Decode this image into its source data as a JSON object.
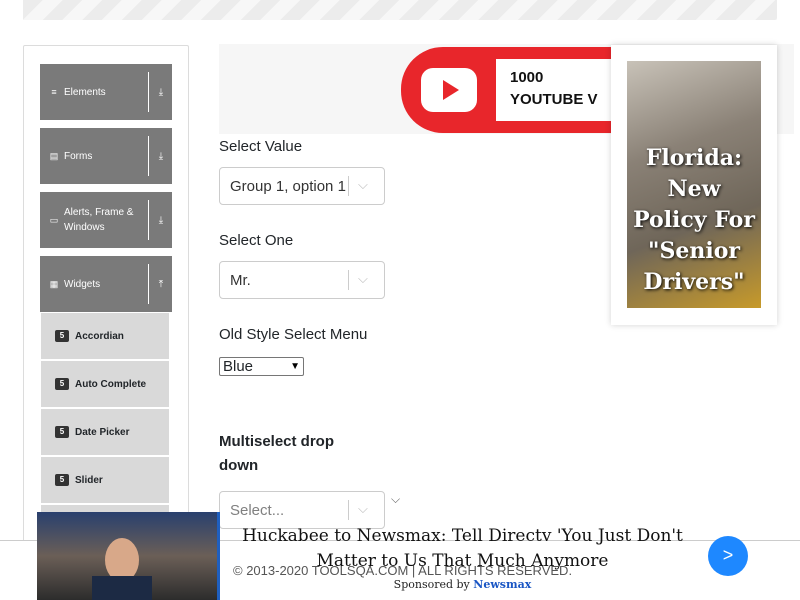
{
  "sidebar": {
    "groups": [
      {
        "label": "Elements",
        "icon": "≡",
        "arrow": "⤓"
      },
      {
        "label": "Forms",
        "icon": "▤",
        "arrow": "⤓"
      },
      {
        "label": "Alerts, Frame & Windows",
        "icon": "▭",
        "arrow": "⤓"
      },
      {
        "label": "Widgets",
        "icon": "▦",
        "arrow": "⤒"
      }
    ],
    "widget_items": [
      {
        "label": "Accordian"
      },
      {
        "label": "Auto Complete"
      },
      {
        "label": "Date Picker"
      },
      {
        "label": "Slider"
      }
    ],
    "item_icon": "5"
  },
  "top_ad": {
    "line1": "1000",
    "line2": "YOUTUBE V"
  },
  "form": {
    "select_value": {
      "label": "Select Value",
      "value": "Group 1, option 1"
    },
    "select_one": {
      "label": "Select One",
      "value": "Mr."
    },
    "old_style": {
      "label": "Old Style Select Menu",
      "value": "Blue"
    },
    "multiselect": {
      "label": "Multiselect drop down",
      "placeholder": "Select..."
    },
    "chevron": "⌵",
    "native_arrow": "▼"
  },
  "side_ad": {
    "headline": "Florida: New Policy For \"Senior Drivers\""
  },
  "footer": {
    "copyright": "© 2013-2020 TOOLSQA.COM | ALL RIGHTS RESERVED."
  },
  "bottom_ad": {
    "headline": "Huckabee to Newsmax: Tell Directv 'You Just Don't Matter to Us That Much Anymore",
    "sponsored_prefix": "Sponsored by",
    "sponsor": "Newsmax",
    "next_label": ">"
  },
  "colors": {
    "group_bg": "#7a7a7a",
    "item_bg": "#d9d9d9",
    "youtube_red": "#e8262b",
    "next_button": "#1e88ff"
  }
}
